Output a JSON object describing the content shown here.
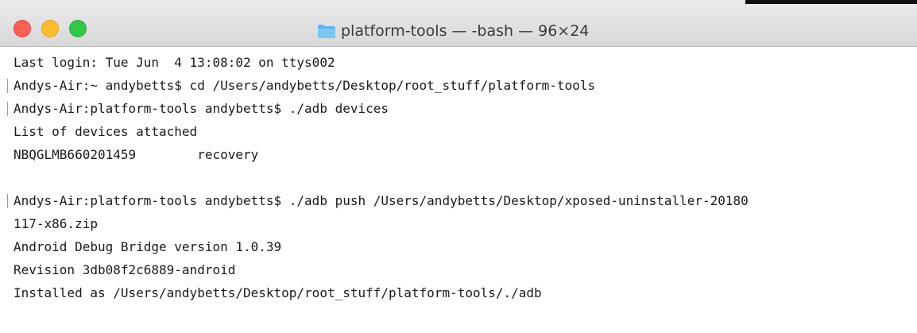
{
  "window": {
    "title": "platform-tools — -bash — 96×24",
    "icon": "folder-icon",
    "colors": {
      "close": "#fc5f57",
      "minimize": "#fdbc2e",
      "zoom": "#33c748",
      "folder": "#5fb6ec"
    }
  },
  "terminal": {
    "lines": [
      "Last login: Tue Jun  4 13:08:02 on ttys002",
      "Andys-Air:~ andybetts$ cd /Users/andybetts/Desktop/root_stuff/platform-tools",
      "Andys-Air:platform-tools andybetts$ ./adb devices",
      "List of devices attached",
      "NBQGLMB660201459        recovery",
      "",
      "Andys-Air:platform-tools andybetts$ ./adb push /Users/andybetts/Desktop/xposed-uninstaller-20180",
      "117-x86.zip",
      "Android Debug Bridge version 1.0.39",
      "Revision 3db08f2c6889-android",
      "Installed as /Users/andybetts/Desktop/root_stuff/platform-tools/./adb"
    ]
  }
}
